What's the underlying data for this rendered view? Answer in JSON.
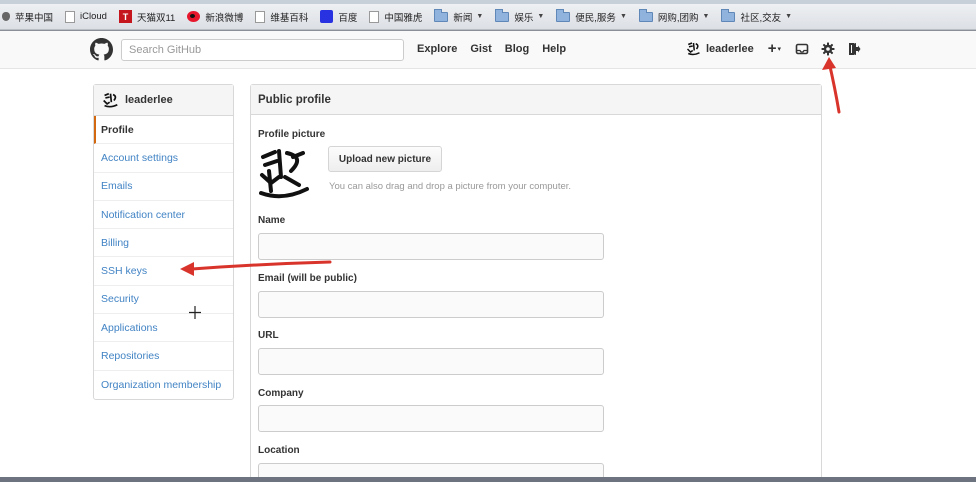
{
  "bookmarks": [
    {
      "label": "苹果中国",
      "icon": "apple-icon"
    },
    {
      "label": "iCloud",
      "icon": "page-icon"
    },
    {
      "label": "天猫双11",
      "icon": "tmall-icon"
    },
    {
      "label": "新浪微博",
      "icon": "weibo-icon"
    },
    {
      "label": "维基百科",
      "icon": "page-icon"
    },
    {
      "label": "百度",
      "icon": "baidu-icon"
    },
    {
      "label": "中国雅虎",
      "icon": "page-icon"
    },
    {
      "label": "新闻",
      "icon": "folder-icon",
      "dropdown": true
    },
    {
      "label": "娱乐",
      "icon": "folder-icon",
      "dropdown": true
    },
    {
      "label": "便民,服务",
      "icon": "folder-icon",
      "dropdown": true
    },
    {
      "label": "网购,团购",
      "icon": "folder-icon",
      "dropdown": true
    },
    {
      "label": "社区,交友",
      "icon": "folder-icon",
      "dropdown": true
    }
  ],
  "header": {
    "search_placeholder": "Search GitHub",
    "nav": [
      "Explore",
      "Gist",
      "Blog",
      "Help"
    ],
    "username": "leaderlee",
    "plus_label": "+",
    "caret": "▾"
  },
  "sidebar": {
    "title": "leaderlee",
    "items": [
      {
        "label": "Profile",
        "active": true
      },
      {
        "label": "Account settings"
      },
      {
        "label": "Emails"
      },
      {
        "label": "Notification center"
      },
      {
        "label": "Billing"
      },
      {
        "label": "SSH keys"
      },
      {
        "label": "Security"
      },
      {
        "label": "Applications"
      },
      {
        "label": "Repositories"
      },
      {
        "label": "Organization membership"
      }
    ]
  },
  "main": {
    "title": "Public profile",
    "picture_label": "Profile picture",
    "upload_button": "Upload new picture",
    "upload_hint": "You can also drag and drop a picture from your computer.",
    "fields": [
      {
        "label": "Name",
        "value": ""
      },
      {
        "label": "Email (will be public)",
        "value": ""
      },
      {
        "label": "URL",
        "value": ""
      },
      {
        "label": "Company",
        "value": ""
      },
      {
        "label": "Location",
        "value": ""
      }
    ]
  },
  "colors": {
    "link": "#4183c4",
    "active_border": "#d26911",
    "annotation_arrow": "#d9342b"
  }
}
